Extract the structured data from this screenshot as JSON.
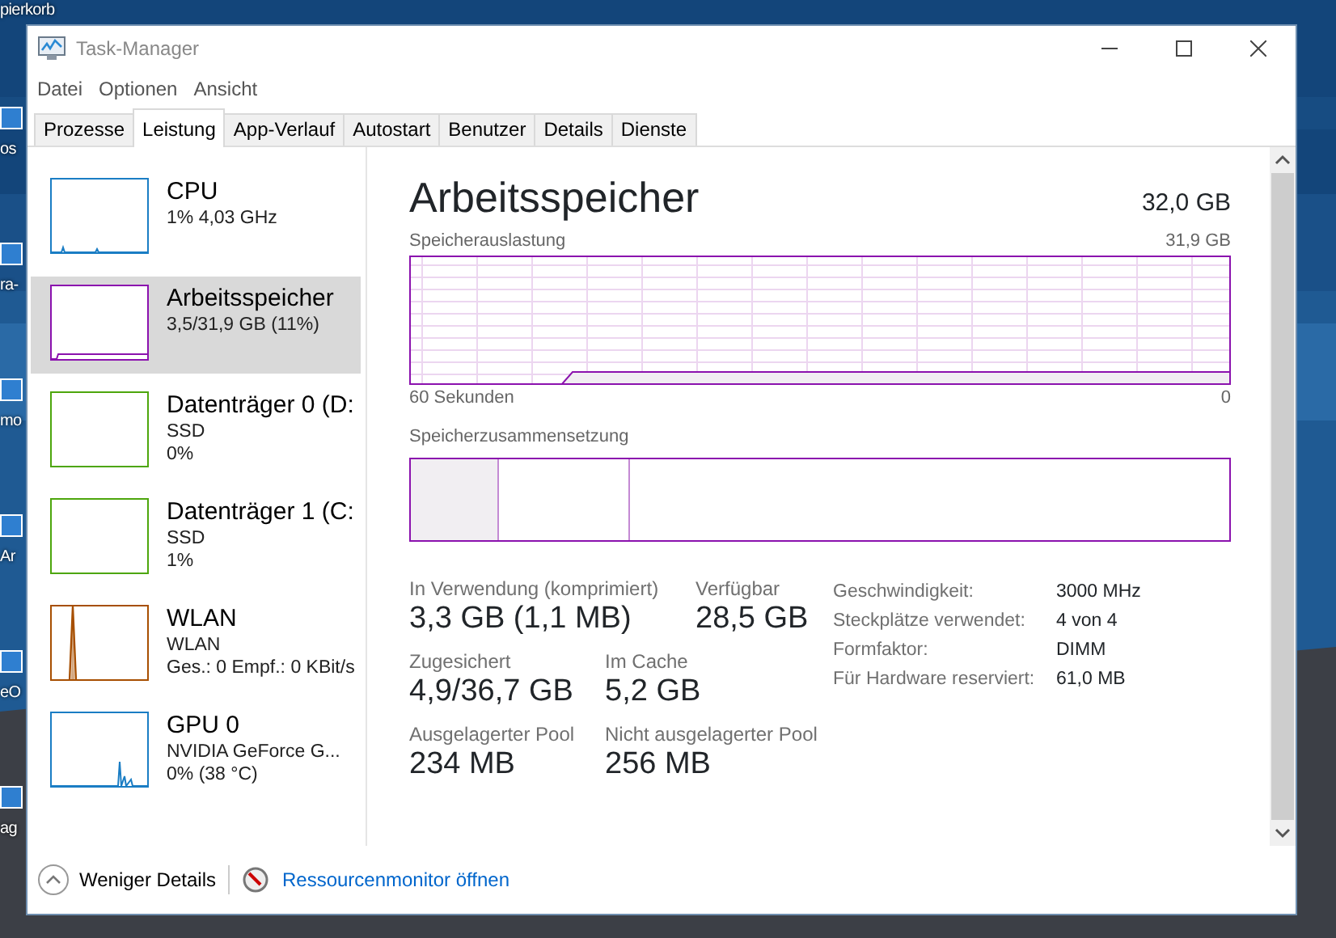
{
  "desktop": {
    "icons": [
      {
        "label": "pierkorb"
      },
      {
        "label": "os"
      },
      {
        "label": "ra-"
      },
      {
        "label": "mo"
      },
      {
        "label": "Ar"
      },
      {
        "label": "eO"
      },
      {
        "label": "ag"
      }
    ]
  },
  "window": {
    "title": "Task-Manager"
  },
  "menu": [
    "Datei",
    "Optionen",
    "Ansicht"
  ],
  "tabs": [
    {
      "label": "Prozesse",
      "selected": false
    },
    {
      "label": "Leistung",
      "selected": true
    },
    {
      "label": "App-Verlauf",
      "selected": false
    },
    {
      "label": "Autostart",
      "selected": false
    },
    {
      "label": "Benutzer",
      "selected": false
    },
    {
      "label": "Details",
      "selected": false
    },
    {
      "label": "Dienste",
      "selected": false
    }
  ],
  "sidebar": {
    "items": [
      {
        "kind": "cpu",
        "title": "CPU",
        "lines": [
          "1% 4,03 GHz"
        ],
        "color": "#1a7dc4",
        "selected": false
      },
      {
        "kind": "memory",
        "title": "Arbeitsspeicher",
        "lines": [
          "3,5/31,9 GB (11%)"
        ],
        "color": "#8b12ae",
        "selected": true
      },
      {
        "kind": "disk",
        "title": "Datenträger 0 (D:",
        "lines": [
          "SSD",
          "0%"
        ],
        "color": "#4da60c",
        "selected": false
      },
      {
        "kind": "disk",
        "title": "Datenträger 1 (C:",
        "lines": [
          "SSD",
          "1%"
        ],
        "color": "#4da60c",
        "selected": false
      },
      {
        "kind": "network",
        "title": "WLAN",
        "lines": [
          "WLAN",
          "Ges.: 0 Empf.: 0 KBit/s"
        ],
        "color": "#a74f01",
        "selected": false
      },
      {
        "kind": "gpu",
        "title": "GPU 0",
        "lines": [
          "NVIDIA GeForce G...",
          "0% (38 °C)"
        ],
        "color": "#1a7dc4",
        "selected": false
      }
    ]
  },
  "detail": {
    "title": "Arbeitsspeicher",
    "total": "32,0 GB",
    "usage_label": "Speicherauslastung",
    "usage_max": "31,9 GB",
    "time_start": "60 Sekunden",
    "time_end": "0",
    "composition_label": "Speicherzusammensetzung",
    "stat_rows": [
      {
        "items": [
          {
            "label": "In Verwendung (komprimiert)",
            "value": "3,3 GB (1,1 MB)"
          },
          {
            "label": "Verfügbar",
            "value": "28,5 GB"
          }
        ]
      },
      {
        "items": [
          {
            "label": "Zugesichert",
            "value": "4,9/36,7 GB"
          },
          {
            "label": "Im Cache",
            "value": "5,2 GB"
          }
        ]
      },
      {
        "items": [
          {
            "label": "Ausgelagerter Pool",
            "value": "234 MB"
          },
          {
            "label": "Nicht ausgelagerter Pool",
            "value": "256 MB"
          }
        ]
      }
    ],
    "properties": [
      {
        "label": "Geschwindigkeit:",
        "value": "3000 MHz"
      },
      {
        "label": "Steckplätze verwendet:",
        "value": "4 von 4"
      },
      {
        "label": "Formfaktor:",
        "value": "DIMM"
      },
      {
        "label": "Für Hardware reserviert:",
        "value": "61,0 MB"
      }
    ]
  },
  "footer": {
    "less_details": "Weniger Details",
    "monitor_link": "Ressourcenmonitor öffnen"
  }
}
